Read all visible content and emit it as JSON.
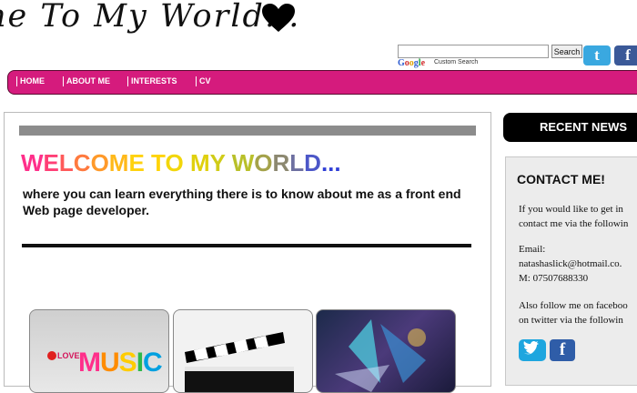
{
  "header": {
    "site_title": "ne To My World...",
    "search_button": "Search",
    "search_value": "",
    "powered_by": "Custom Search"
  },
  "nav": {
    "items": [
      {
        "label": "HOME"
      },
      {
        "label": "ABOUT ME"
      },
      {
        "label": "INTERESTS"
      },
      {
        "label": "CV"
      }
    ]
  },
  "main": {
    "welcome": {
      "letters": [
        "W",
        "E",
        "L",
        "C",
        "O",
        "M",
        "E",
        " ",
        "T",
        "O",
        " ",
        "M",
        "Y",
        " ",
        "W",
        "O",
        "R",
        "L",
        "D",
        "..."
      ]
    },
    "intro": "where you can learn everything there is to know about me as a front end Web page developer.",
    "cards": [
      {
        "label": "LOVE"
      },
      {
        "label": "MUSIC"
      }
    ]
  },
  "sidebar": {
    "recent_news": "RECENT NEWS",
    "contact_title": "CONTACT ME!",
    "contact_line1": "If you would like to get in",
    "contact_line2": "contact me via the followin",
    "email_label": "Email:",
    "email_value": "natashaslick@hotmail.co.",
    "mobile": "M: 07507688330",
    "follow_line1": "Also follow me on faceboo",
    "follow_line2": "on twitter via the followin"
  },
  "colors": {
    "nav_pink": "#d51b7d",
    "black": "#000000",
    "twitter_blue": "#1ea6df",
    "facebook_blue": "#3b5998"
  }
}
